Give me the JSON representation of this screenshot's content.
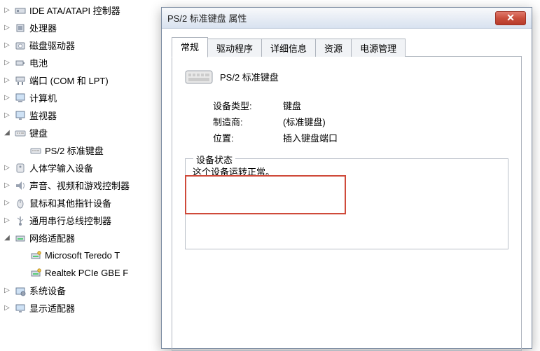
{
  "tree": {
    "items": [
      {
        "label": "IDE ATA/ATAPI 控制器",
        "icon": "ide",
        "expand": "▷",
        "level": 0
      },
      {
        "label": "处理器",
        "icon": "cpu",
        "expand": "▷",
        "level": 0
      },
      {
        "label": "磁盘驱动器",
        "icon": "disk",
        "expand": "▷",
        "level": 0
      },
      {
        "label": "电池",
        "icon": "battery",
        "expand": "▷",
        "level": 0
      },
      {
        "label": "端口 (COM 和 LPT)",
        "icon": "port",
        "expand": "▷",
        "level": 0
      },
      {
        "label": "计算机",
        "icon": "computer",
        "expand": "▷",
        "level": 0
      },
      {
        "label": "监视器",
        "icon": "monitor",
        "expand": "▷",
        "level": 0
      },
      {
        "label": "键盘",
        "icon": "keyboard",
        "expand": "◢",
        "level": 0
      },
      {
        "label": "PS/2 标准键盘",
        "icon": "keyboard",
        "expand": "",
        "level": 1
      },
      {
        "label": "人体学输入设备",
        "icon": "hid",
        "expand": "▷",
        "level": 0
      },
      {
        "label": "声音、视频和游戏控制器",
        "icon": "sound",
        "expand": "▷",
        "level": 0
      },
      {
        "label": "鼠标和其他指针设备",
        "icon": "mouse",
        "expand": "▷",
        "level": 0
      },
      {
        "label": "通用串行总线控制器",
        "icon": "usb",
        "expand": "▷",
        "level": 0
      },
      {
        "label": "网络适配器",
        "icon": "network",
        "expand": "◢",
        "level": 0
      },
      {
        "label": "Microsoft Teredo T",
        "icon": "nic",
        "expand": "",
        "level": 1
      },
      {
        "label": "Realtek PCIe GBE F",
        "icon": "nic",
        "expand": "",
        "level": 1
      },
      {
        "label": "系统设备",
        "icon": "system",
        "expand": "▷",
        "level": 0
      },
      {
        "label": "显示适配器",
        "icon": "display",
        "expand": "▷",
        "level": 0
      }
    ]
  },
  "dialog": {
    "title": "PS/2 标准键盘 属性",
    "close_symbol": "✕",
    "tabs": [
      "常规",
      "驱动程序",
      "详细信息",
      "资源",
      "电源管理"
    ],
    "active_tab": 0,
    "device_name": "PS/2 标准键盘",
    "rows": [
      {
        "k": "设备类型:",
        "v": "键盘"
      },
      {
        "k": "制造商:",
        "v": "(标准键盘)"
      },
      {
        "k": "位置:",
        "v": "插入键盘端口"
      }
    ],
    "status_label": "设备状态",
    "status_text": "这个设备运转正常。"
  }
}
